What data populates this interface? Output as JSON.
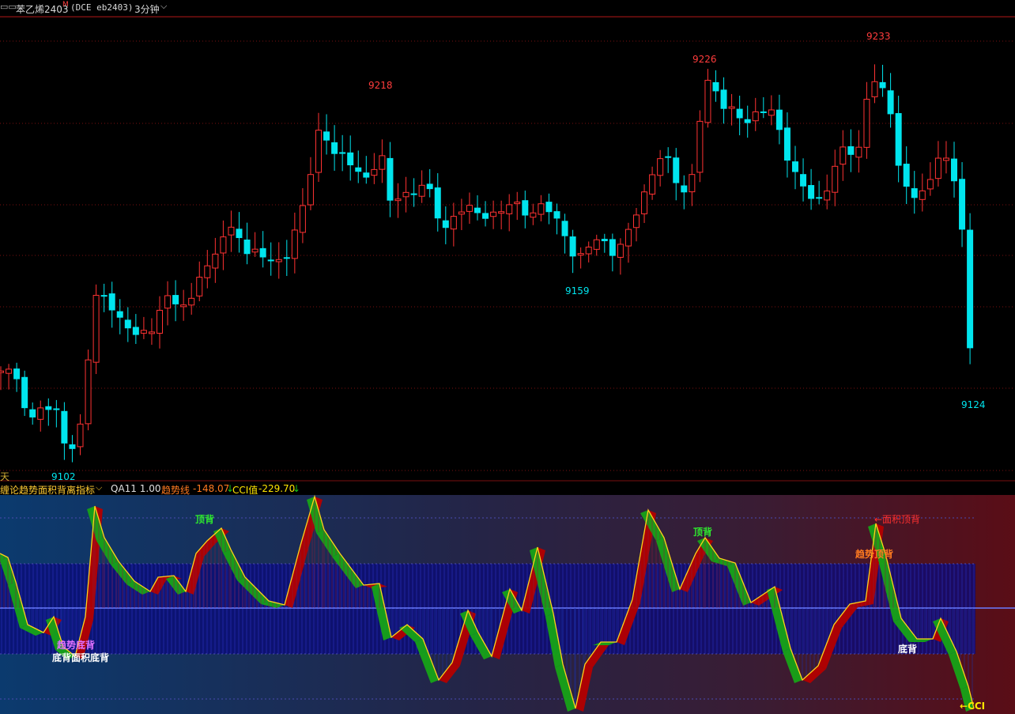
{
  "title_bar": {
    "window_icon": "window-restore-icon",
    "symbol_name": "苯乙烯2403",
    "main_contract_mark": "M",
    "exchange_code": "(DCE  eb2403)",
    "period": "3分钟",
    "period_dropdown_icon": "chevron-down-icon"
  },
  "main_chart": {
    "price_labels": {
      "low_left": "9102",
      "high_1": "9218",
      "low_mid": "9159",
      "high_2": "9226",
      "high_3": "9233",
      "low_right": "9124"
    },
    "day_marker": "天",
    "colors": {
      "up": "#ff3232",
      "down": "#00e5ee",
      "grid": "#7a1010",
      "high_label": "#ff3c3c",
      "low_label": "#00e5ee"
    }
  },
  "indicator": {
    "name": "缠论趋势面积背离指标",
    "name_dropdown_icon": "chevron-down-icon",
    "params": "QA11 1.00",
    "trend_label": "趋势线",
    "trend_value": "-148.07",
    "trend_arrow": "↓",
    "cci_label": "CCI值",
    "cci_value": "-229.70",
    "cci_arrow": "↓",
    "signals": {
      "top_div_1": "顶背",
      "top_div_2": "顶背",
      "area_top_div": "←面积顶背",
      "trend_top_div": "趋势顶背",
      "trend_bottom_div": "趋势底背",
      "bottom_div_area": "底背面积底背",
      "bottom_div_right": "底背",
      "cci_tag": "←CCI"
    },
    "colors": {
      "trend_value": "#ff7a20",
      "cci_value": "#ffe600",
      "up_fill": "#b40000",
      "down_fill": "#17a317",
      "mid_line": "#6b7cff"
    }
  }
}
